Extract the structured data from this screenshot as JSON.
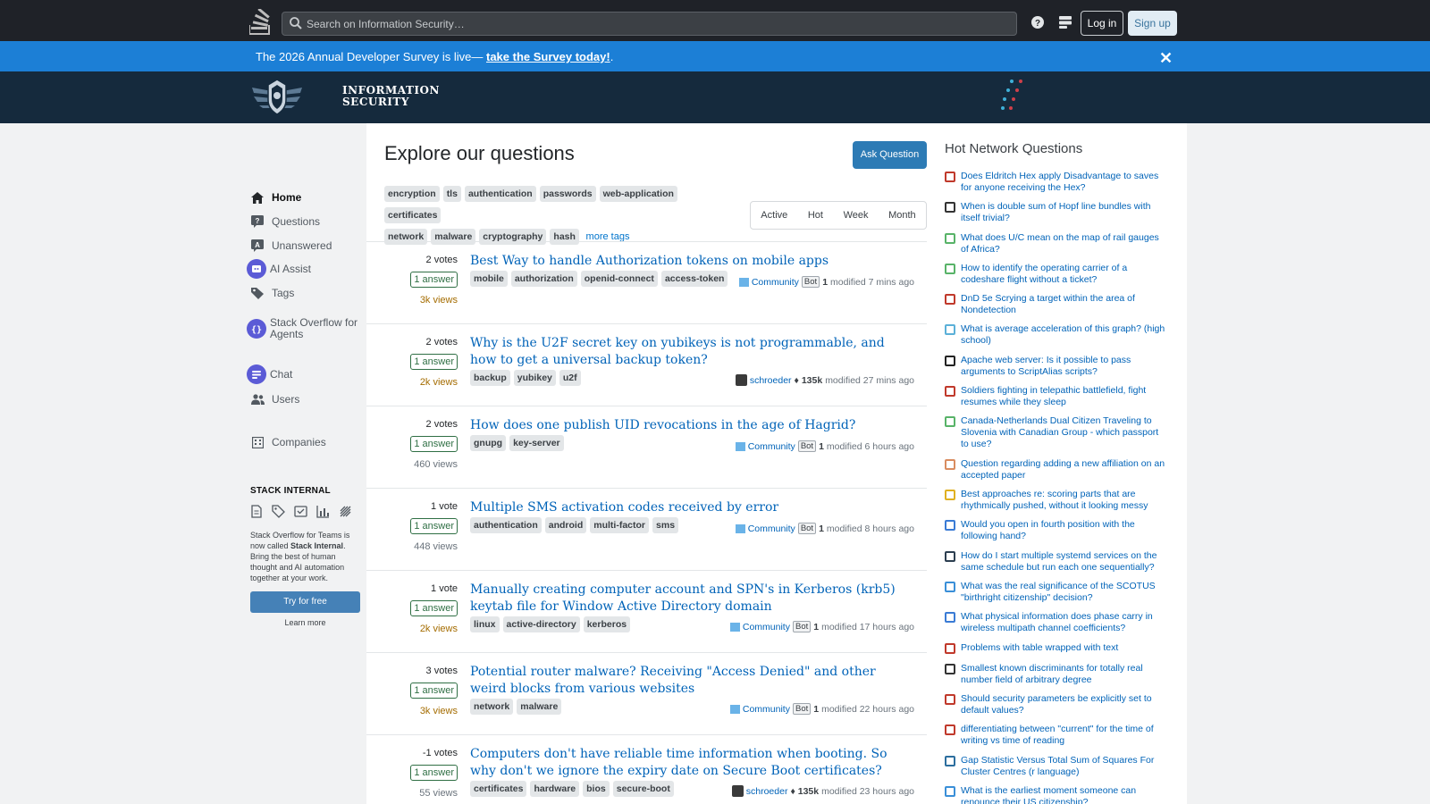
{
  "topbar": {
    "search_placeholder": "Search on Information Security…",
    "login_label": "Log in",
    "signup_label": "Sign up"
  },
  "banner": {
    "text_before": "The 2026 Annual Developer Survey is live— ",
    "link_text": "take the Survey today!",
    "text_after": "."
  },
  "site": {
    "name_line1": "INFORMATION",
    "name_line2": "SECURITY"
  },
  "leftnav": {
    "items": [
      {
        "label": "Home",
        "icon": "home-icon"
      },
      {
        "label": "Questions",
        "icon": "questions-icon"
      },
      {
        "label": "Unanswered",
        "icon": "unanswered-icon"
      },
      {
        "label": "AI Assist",
        "icon": "ai-assist-icon"
      },
      {
        "label": "Tags",
        "icon": "tag-icon"
      },
      {
        "label": "Stack Overflow for Agents",
        "icon": "agents-icon"
      },
      {
        "label": "Chat",
        "icon": "chat-icon"
      },
      {
        "label": "Users",
        "icon": "users-icon"
      },
      {
        "label": "Companies",
        "icon": "companies-icon"
      }
    ],
    "stack_internal_title": "STACK INTERNAL",
    "stack_internal_text_before": "Stack Overflow for Teams is now called ",
    "stack_internal_bold": "Stack Internal",
    "stack_internal_text_after": ". Bring the best of human thought and AI automation together at your work.",
    "try_label": "Try for free",
    "learn_label": "Learn more"
  },
  "main": {
    "title": "Explore our questions",
    "ask_label": "Ask Question",
    "tags": [
      "encryption",
      "tls",
      "authentication",
      "passwords",
      "web-application",
      "certificates",
      "network",
      "malware",
      "cryptography",
      "hash"
    ],
    "more_tags": "more tags",
    "filters": [
      "Active",
      "Hot",
      "Week",
      "Month"
    ],
    "questions": [
      {
        "votes": "2 votes",
        "answers": "1 answer",
        "views": "3k views",
        "hot": true,
        "title": "Best Way to handle Authorization tokens on mobile apps",
        "tags": [
          "mobile",
          "authorization",
          "openid-connect",
          "access-token"
        ],
        "user": "Community",
        "bot": "Bot",
        "rep": "1",
        "modified": "modified 7 mins ago"
      },
      {
        "votes": "2 votes",
        "answers": "1 answer",
        "views": "2k views",
        "hot": true,
        "title": "Why is the U2F secret key on yubikeys is not programmable, and how to get a universal backup token?",
        "tags": [
          "backup",
          "yubikey",
          "u2f"
        ],
        "user": "schroeder",
        "rep": "♦ 135k",
        "modified": "modified 27 mins ago"
      },
      {
        "votes": "2 votes",
        "answers": "1 answer",
        "views": "460 views",
        "hot": false,
        "title": "How does one publish UID revocations in the age of Hagrid?",
        "tags": [
          "gnupg",
          "key-server"
        ],
        "user": "Community",
        "bot": "Bot",
        "rep": "1",
        "modified": "modified 6 hours ago"
      },
      {
        "votes": "1 vote",
        "answers": "1 answer",
        "views": "448 views",
        "hot": false,
        "title": "Multiple SMS activation codes received by error",
        "tags": [
          "authentication",
          "android",
          "multi-factor",
          "sms"
        ],
        "user": "Community",
        "bot": "Bot",
        "rep": "1",
        "modified": "modified 8 hours ago"
      },
      {
        "votes": "1 vote",
        "answers": "1 answer",
        "views": "2k views",
        "hot": true,
        "title": "Manually creating computer account and SPN's in Kerberos (krb5) keytab file for Window Active Directory domain",
        "tags": [
          "linux",
          "active-directory",
          "kerberos"
        ],
        "user": "Community",
        "bot": "Bot",
        "rep": "1",
        "modified": "modified 17 hours ago"
      },
      {
        "votes": "3 votes",
        "answers": "1 answer",
        "views": "3k views",
        "hot": true,
        "title": "Potential router malware? Receiving \"Access Denied\" and other weird blocks from various websites",
        "tags": [
          "network",
          "malware"
        ],
        "user": "Community",
        "bot": "Bot",
        "rep": "1",
        "modified": "modified 22 hours ago"
      },
      {
        "votes": "-1 votes",
        "answers": "1 answer",
        "views": "55 views",
        "hot": false,
        "title": "Computers don't have reliable time information when booting. So why don't we ignore the expiry date on Secure Boot certificates?",
        "tags": [
          "certificates",
          "hardware",
          "bios",
          "secure-boot"
        ],
        "user": "schroeder",
        "rep": "♦ 135k",
        "modified": "modified 23 hours ago"
      }
    ]
  },
  "sidebar": {
    "title": "Hot Network Questions",
    "items": [
      {
        "text": "Does Eldritch Hex apply Disadvantage to saves for anyone receiving the Hex?",
        "color": "#c0392b"
      },
      {
        "text": "When is double sum of Hopf line bundles with itself trivial?",
        "color": "#333333"
      },
      {
        "text": "What does U/C mean on the map of rail gauges of Africa?",
        "color": "#58b368"
      },
      {
        "text": "How to identify the operating carrier of a codeshare flight without a ticket?",
        "color": "#58b368"
      },
      {
        "text": "DnD 5e Scrying a target within the area of Nondetection",
        "color": "#c0392b"
      },
      {
        "text": "What is average acceleration of this graph? (high school)",
        "color": "#5bb0d8"
      },
      {
        "text": "Apache web server: Is it possible to pass arguments to ScriptAlias scripts?",
        "color": "#222222"
      },
      {
        "text": "Soldiers fighting in telepathic battlefield, fight resumes while they sleep",
        "color": "#c0392b"
      },
      {
        "text": "Canada-Netherlands Dual Citizen Traveling to Slovenia with Canadian Group - which passport to use?",
        "color": "#58b368"
      },
      {
        "text": "Question regarding adding a new affiliation on an accepted paper",
        "color": "#d98c5f"
      },
      {
        "text": "Best approaches re: scoring parts that are rhythmically pushed, without it looking messy",
        "color": "#e0b020"
      },
      {
        "text": "Would you open in fourth position with the following hand?",
        "color": "#3a7bd5"
      },
      {
        "text": "How do I start multiple systemd services on the same schedule but run each one sequentially?",
        "color": "#2c3e50"
      },
      {
        "text": "What was the real significance of the SCOTUS \"birthright citizenship\" decision?",
        "color": "#3a8fd8"
      },
      {
        "text": "What physical information does phase carry in wireless multipath channel coefficients?",
        "color": "#3a7bd5"
      },
      {
        "text": "Problems with table wrapped with text",
        "color": "#c0392b"
      },
      {
        "text": "Smallest known discriminants for totally real number field of arbitrary degree",
        "color": "#333333"
      },
      {
        "text": "Should security parameters be explicitly set to default values?",
        "color": "#c0392b"
      },
      {
        "text": "differentiating between \"current\" for the time of writing vs time of reading",
        "color": "#c0392b"
      },
      {
        "text": "Gap Statistic Versus Total Sum of Squares For Cluster Centres (r language)",
        "color": "#2c6e9e"
      },
      {
        "text": "What is the earliest moment someone can renounce their US citizenship?",
        "color": "#3a8fd8"
      }
    ]
  }
}
